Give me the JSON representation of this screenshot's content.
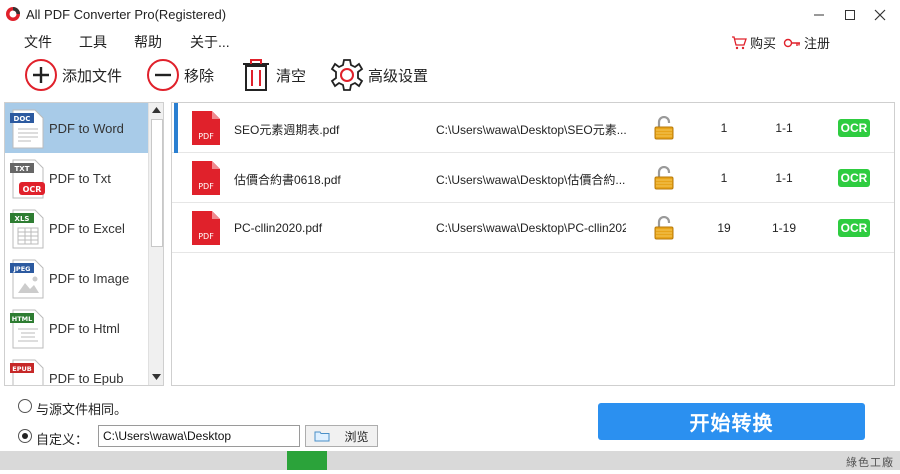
{
  "window": {
    "title": "All PDF Converter Pro(Registered)"
  },
  "menu": {
    "items": [
      "文件",
      "工具",
      "帮助",
      "关于..."
    ]
  },
  "topright": {
    "buy": "购买",
    "register": "注册"
  },
  "toolbar": {
    "add": "添加文件",
    "remove": "移除",
    "clear": "清空",
    "settings": "高级设置"
  },
  "sidebar": {
    "items": [
      {
        "label": "PDF to Word",
        "tag": "DOC",
        "tag_color": "#2c5aa0"
      },
      {
        "label": "PDF to Txt",
        "tag": "TXT",
        "tag_color": "#666666",
        "badge": "OCR"
      },
      {
        "label": "PDF to Excel",
        "tag": "XLS",
        "tag_color": "#2e7d32"
      },
      {
        "label": "PDF to Image",
        "tag": "JPEG",
        "tag_color": "#2c5aa0"
      },
      {
        "label": "PDF to Html",
        "tag": "HTML",
        "tag_color": "#2e7d32"
      },
      {
        "label": "PDF to Epub",
        "tag": "EPUB",
        "tag_color": "#c62828"
      }
    ]
  },
  "files": {
    "icon_label": "PDF",
    "rows": [
      {
        "name": "SEO元素週期表.pdf",
        "path": "C:\\Users\\wawa\\Desktop\\SEO元素...",
        "pages": "1",
        "range": "1-1",
        "ocr": "OCR"
      },
      {
        "name": "估價合約書0618.pdf",
        "path": "C:\\Users\\wawa\\Desktop\\估價合約...",
        "pages": "1",
        "range": "1-1",
        "ocr": "OCR"
      },
      {
        "name": "PC-cllin2020.pdf",
        "path": "C:\\Users\\wawa\\Desktop\\PC-cllin202...",
        "pages": "19",
        "range": "1-19",
        "ocr": "OCR"
      }
    ]
  },
  "output": {
    "same_as_source": "与源文件相同。",
    "custom": "自定义：",
    "path_value": "C:\\Users\\wawa\\Desktop",
    "browse": "浏览"
  },
  "start": {
    "label": "开始转换"
  },
  "progress": {
    "fraction": 0.05
  },
  "watermark": "綠色工廠",
  "colors": {
    "accent": "#2b90f0",
    "ocr": "#2ecc40",
    "pdf_red": "#e0212b",
    "progress": "#2ba33a"
  }
}
